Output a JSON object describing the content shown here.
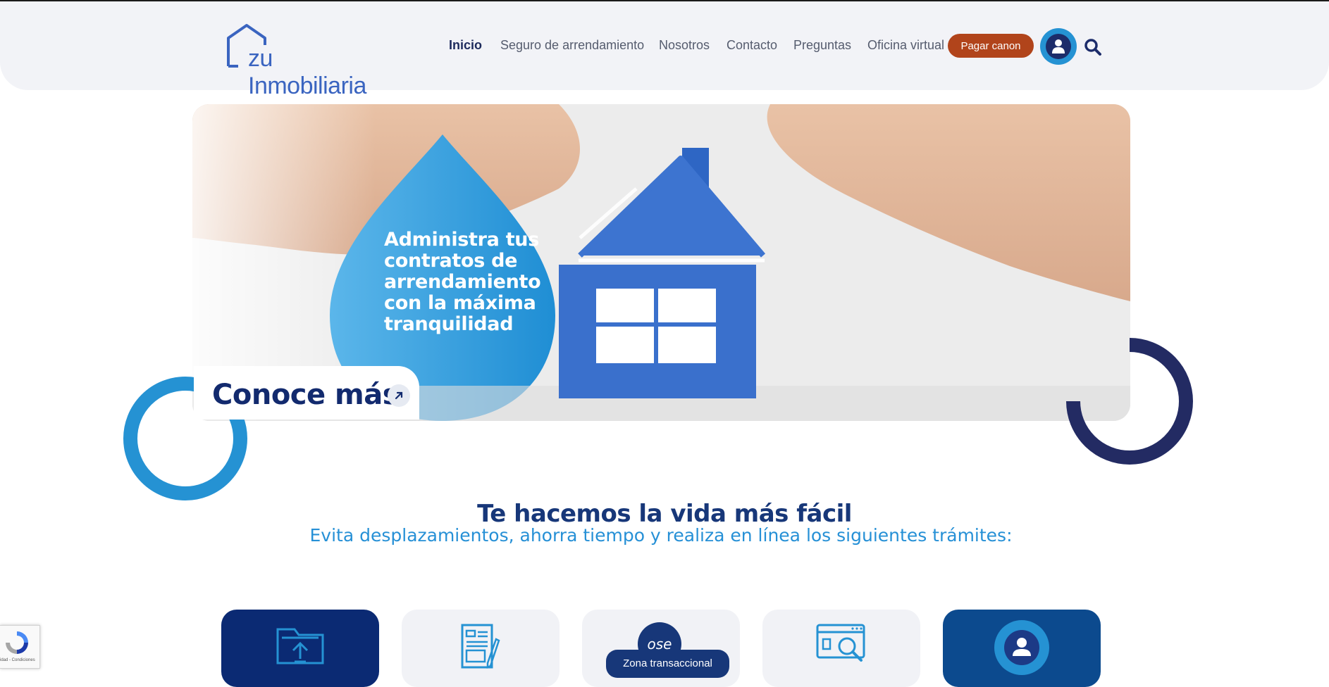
{
  "header": {
    "logo_text": "zu Inmobiliaria",
    "nav": [
      {
        "label": "Inicio"
      },
      {
        "label": "Seguro de arrendamiento"
      },
      {
        "label": "Nosotros"
      },
      {
        "label": "Contacto"
      },
      {
        "label": "Preguntas"
      },
      {
        "label": "Oficina virtual"
      }
    ],
    "pay_button": "Pagar canon"
  },
  "hero": {
    "text_lines": [
      "Administra tus",
      "contratos de",
      "arrendamiento",
      "con la  máxima",
      "tranquilidad"
    ],
    "cta": "Conoce más"
  },
  "section": {
    "title": "Te hacemos la vida más fácil",
    "subtitle": "Evita desplazamientos, ahorra tiempo y realiza en línea los siguientes trámites:"
  },
  "cards": {
    "ose_badge": "ose",
    "zone_label": "Zona transaccional"
  },
  "recaptcha": {
    "footer": "idad - Condiciones"
  },
  "colors": {
    "brand_dark": "#173779",
    "brand_light": "#2592d3",
    "accent": "#b1441b"
  }
}
